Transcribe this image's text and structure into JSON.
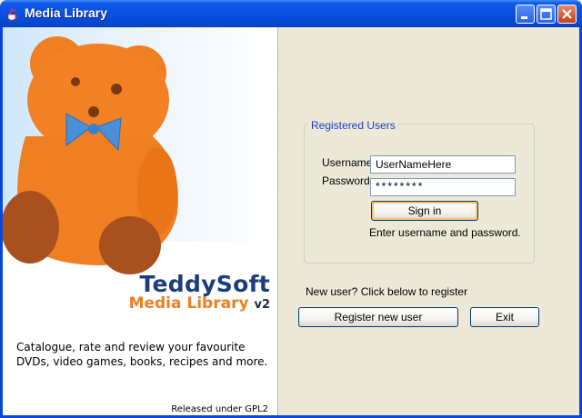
{
  "window": {
    "title": "Media Library"
  },
  "brand": {
    "name": "TeddySoft",
    "product": "Media Library",
    "version": "v2"
  },
  "tagline": "Catalogue, rate and review your favourite DVDs, video games, books, recipes and more.",
  "license": "Released under GPL2",
  "login": {
    "group_title": "Registered Users",
    "username_label": "Username:",
    "username_value": "UserNameHere",
    "password_label": "Password:",
    "password_value": "********",
    "signin_label": "Sign in",
    "status": "Enter username and password."
  },
  "register": {
    "prompt": "New user? Click below to register",
    "register_label": "Register new user",
    "exit_label": "Exit"
  },
  "colors": {
    "titlebar": "#0a4fdf",
    "brand_blue": "#1c3d7c",
    "brand_orange": "#f07e22",
    "teddy": "#f07e22",
    "bowtie": "#4a90d9"
  }
}
